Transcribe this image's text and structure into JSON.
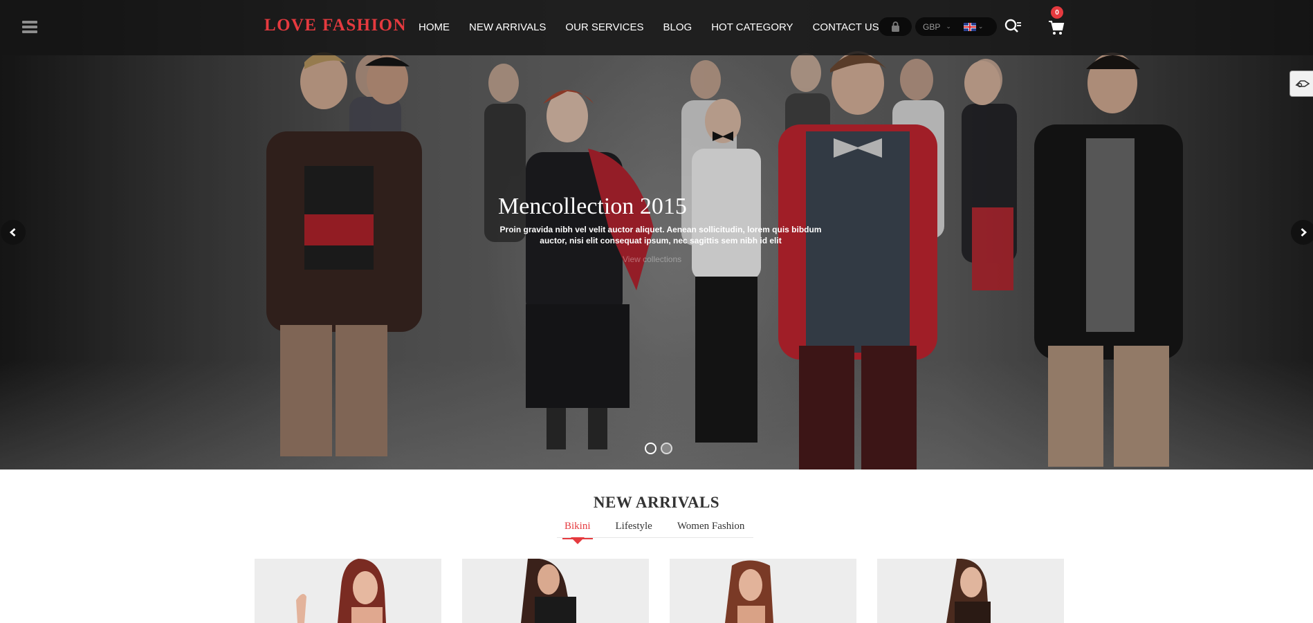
{
  "header": {
    "logo": "LOVE FASHION",
    "nav": [
      "HOME",
      "NEW ARRIVALS",
      "OUR SERVICES",
      "BLOG",
      "HOT CATEGORY",
      "CONTACT US"
    ],
    "currency": "GBP",
    "cart_count": "0"
  },
  "slider": {
    "title": "Mencollection 2015",
    "text": "Proin gravida nibh vel velit auctor aliquet. Aenean sollicitudin, lorem quis bibdum auctor, nisi elit consequat ipsum, nec sagittis sem nibh id elit",
    "link": "View collections",
    "active_slide": 2,
    "total_slides": 2
  },
  "new_arrivals": {
    "title": "NEW ARRIVALS",
    "tabs": [
      "Bikini",
      "Lifestyle",
      "Women Fashion"
    ],
    "active_tab": "Bikini"
  },
  "icons": {
    "menu": "hamburger-menu-icon",
    "lock": "lock-icon",
    "search": "search-icon",
    "cart": "cart-icon",
    "prev": "chevron-left-icon",
    "next": "chevron-right-icon",
    "side": "settings-panel-icon"
  },
  "colors": {
    "accent": "#e53a3f",
    "header_bg": "#141414",
    "product_bg": "#ededed"
  }
}
